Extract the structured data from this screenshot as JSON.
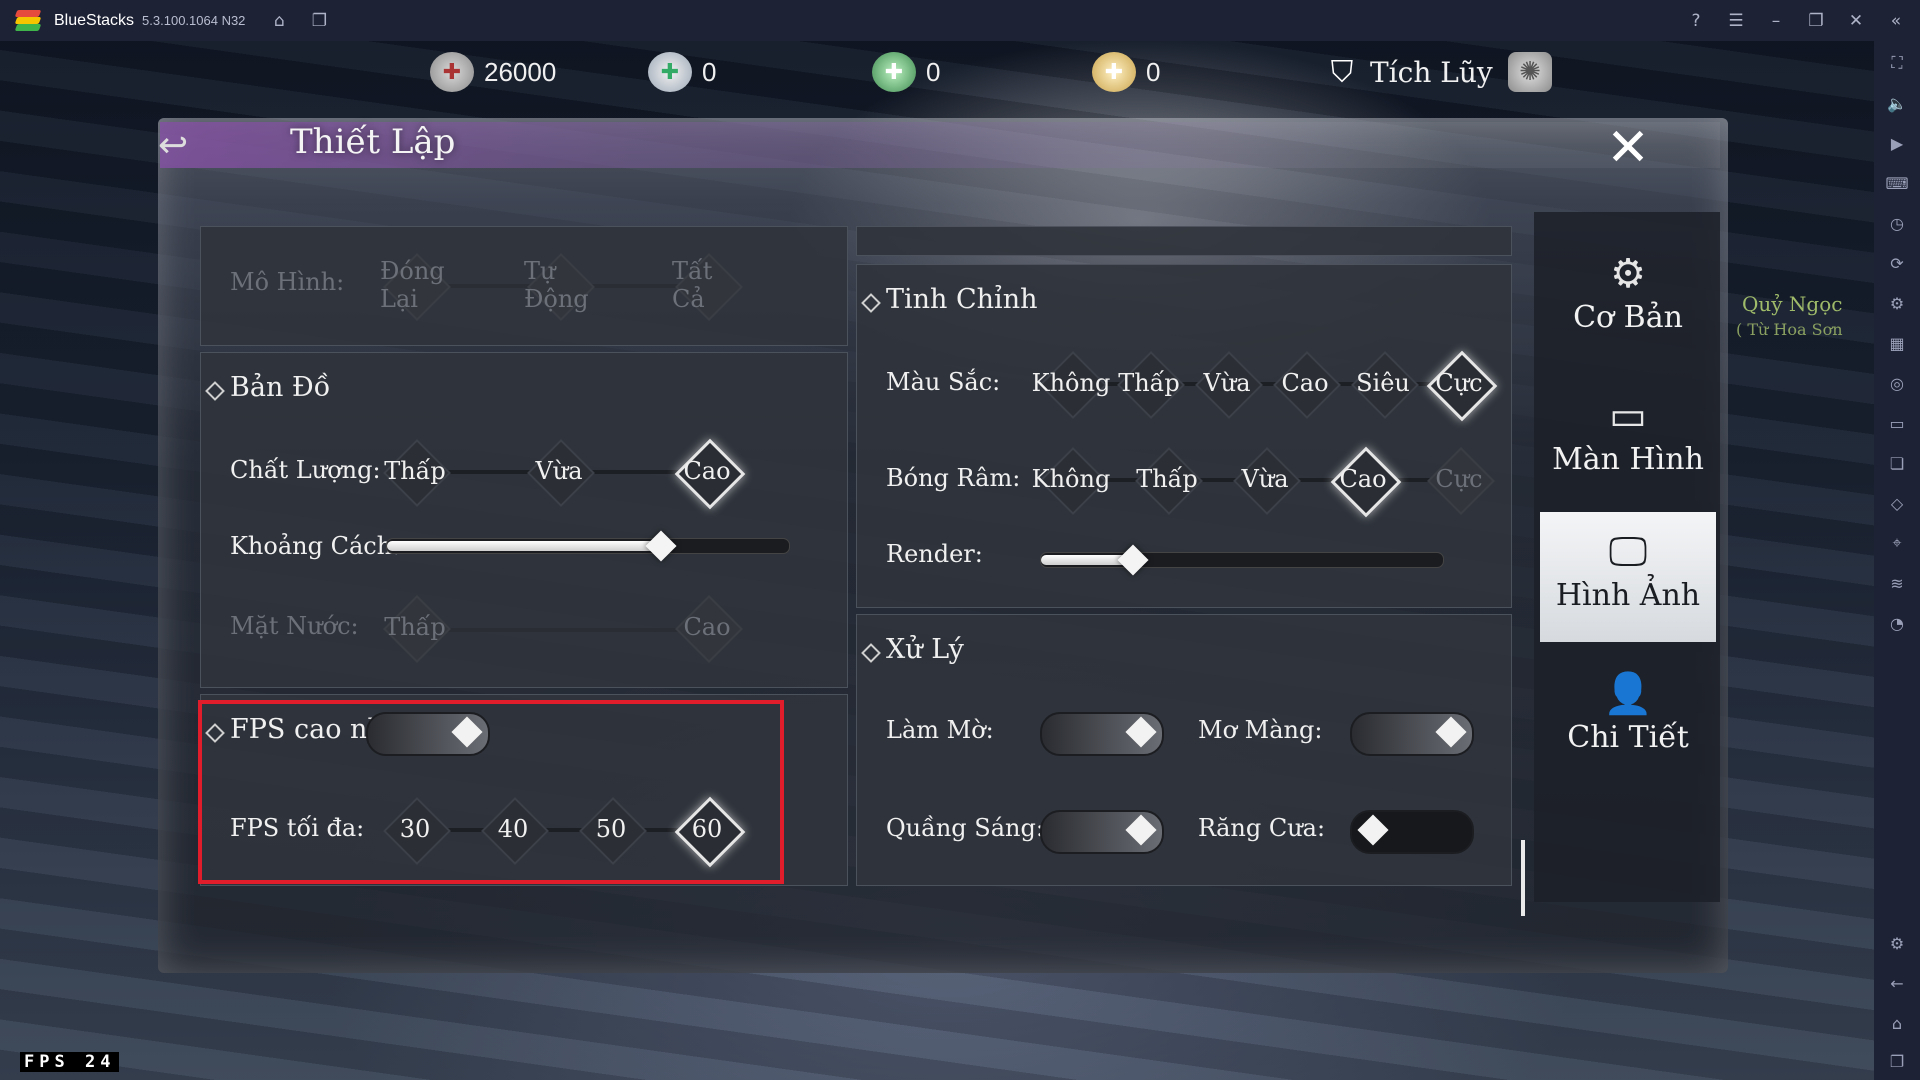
{
  "window": {
    "app_name": "BlueStacks",
    "version": "5.3.100.1064 N32"
  },
  "currencies": [
    {
      "icon": "coin-icon",
      "value": "26000"
    },
    {
      "icon": "ingot-add-icon",
      "value": "0"
    },
    {
      "icon": "jade-add-icon",
      "value": "0"
    },
    {
      "icon": "gold-ingot-add-icon",
      "value": "0"
    }
  ],
  "top_menu": {
    "accumulate_label": "Tích Lũy"
  },
  "panel": {
    "title": "Thiết Lập"
  },
  "model": {
    "label": "Mô Hình:",
    "options": [
      "Đóng Lại",
      "Tự Động",
      "Tất Cả"
    ]
  },
  "map": {
    "title": "Bản Đồ",
    "quality_label": "Chất Lượng:",
    "quality_options": [
      "Thấp",
      "Vừa",
      "Cao"
    ],
    "quality_selected": "Cao",
    "distance_label": "Khoảng Cách:",
    "distance_level": 0.68,
    "water_label": "Mặt Nước:",
    "water_options": [
      "Thấp",
      "Cao"
    ]
  },
  "fps": {
    "max_fps_label": "FPS cao nhất",
    "max_fps_on": true,
    "fps_limit_label": "FPS tối đa:",
    "fps_options": [
      "30",
      "40",
      "50",
      "60"
    ],
    "fps_selected": "60"
  },
  "tuning": {
    "title": "Tinh Chỉnh",
    "color_label": "Màu Sắc:",
    "color_options": [
      "Không",
      "Thấp",
      "Vừa",
      "Cao",
      "Siêu",
      "Cực"
    ],
    "color_selected": "Cực",
    "shadow_label": "Bóng Râm:",
    "shadow_options": [
      "Không",
      "Thấp",
      "Vừa",
      "Cao",
      "Cực"
    ],
    "shadow_selected": "Cao",
    "render_label": "Render:",
    "render_level": 0.23
  },
  "processing": {
    "title": "Xử Lý",
    "blur_label": "Làm Mờ:",
    "blur_on": true,
    "haze_label": "Mơ Màng:",
    "haze_on": true,
    "bloom_label": "Quầng Sáng:",
    "bloom_on": true,
    "aa_label": "Răng Cưa:",
    "aa_on": false
  },
  "tabs": [
    {
      "label": "Cơ Bản",
      "icon": "gear-icon",
      "active": false
    },
    {
      "label": "Màn Hình",
      "icon": "screen-icon",
      "active": false
    },
    {
      "label": "Hình Ảnh",
      "icon": "monitor-image-icon",
      "active": true
    },
    {
      "label": "Chi Tiết",
      "icon": "user-settings-icon",
      "active": false
    }
  ],
  "background_npc": {
    "name": "Quỷ Ngọc",
    "subtitle": "( Từ Hoa Sơn"
  },
  "fps_overlay": {
    "label": "FPS",
    "value": "24"
  },
  "colors": {
    "highlight": "#e11d2b",
    "chrome": "#1e2235"
  }
}
